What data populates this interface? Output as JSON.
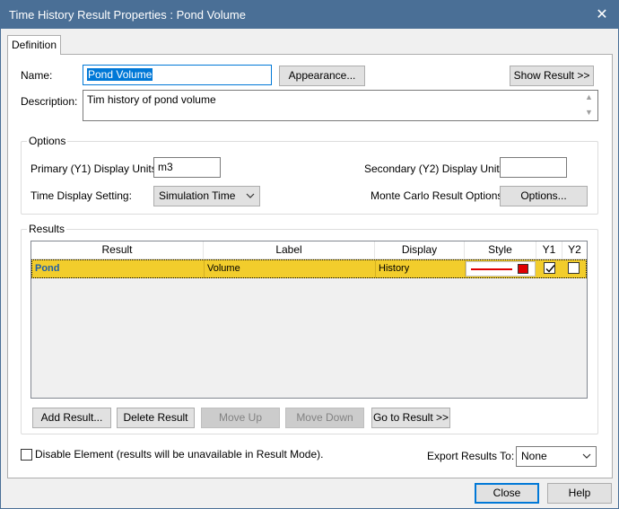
{
  "window": {
    "title": "Time History Result Properties : Pond Volume",
    "close_glyph": "✕"
  },
  "tabs": [
    {
      "label": "Definition"
    }
  ],
  "definition": {
    "name_label": "Name:",
    "name_value": "Pond Volume",
    "appearance_button": "Appearance...",
    "show_result_button": "Show Result >>",
    "description_label": "Description:",
    "description_value": "Tim history of pond volume"
  },
  "options": {
    "group_title": "Options",
    "primary_units_label": "Primary (Y1) Display Units:",
    "primary_units_value": "m3",
    "secondary_units_label": "Secondary (Y2) Display Units:",
    "secondary_units_value": "",
    "time_display_label": "Time Display Setting:",
    "time_display_value": "Simulation Time",
    "monte_carlo_label": "Monte Carlo Result Options:",
    "options_button": "Options..."
  },
  "results": {
    "group_title": "Results",
    "columns": [
      "Result",
      "Label",
      "Display",
      "Style",
      "Y1",
      "Y2"
    ],
    "rows": [
      {
        "result": "Pond",
        "label": "Volume",
        "display": "History",
        "style_color": "#e00000",
        "y1": true,
        "y2": false
      }
    ],
    "buttons": {
      "add": "Add Result...",
      "delete": "Delete Result",
      "move_up": "Move Up",
      "move_down": "Move Down",
      "go_to": "Go to Result >>"
    }
  },
  "footer": {
    "disable_label": "Disable Element (results will be unavailable in Result Mode).",
    "disable_checked": false,
    "export_label": "Export Results To:",
    "export_value": "None",
    "close_button": "Close",
    "help_button": "Help"
  },
  "colors": {
    "titlebar": "#4a6f96",
    "row_highlight": "#f2cd2c",
    "result_text": "#1f5fa8",
    "accent": "#0078d7"
  }
}
